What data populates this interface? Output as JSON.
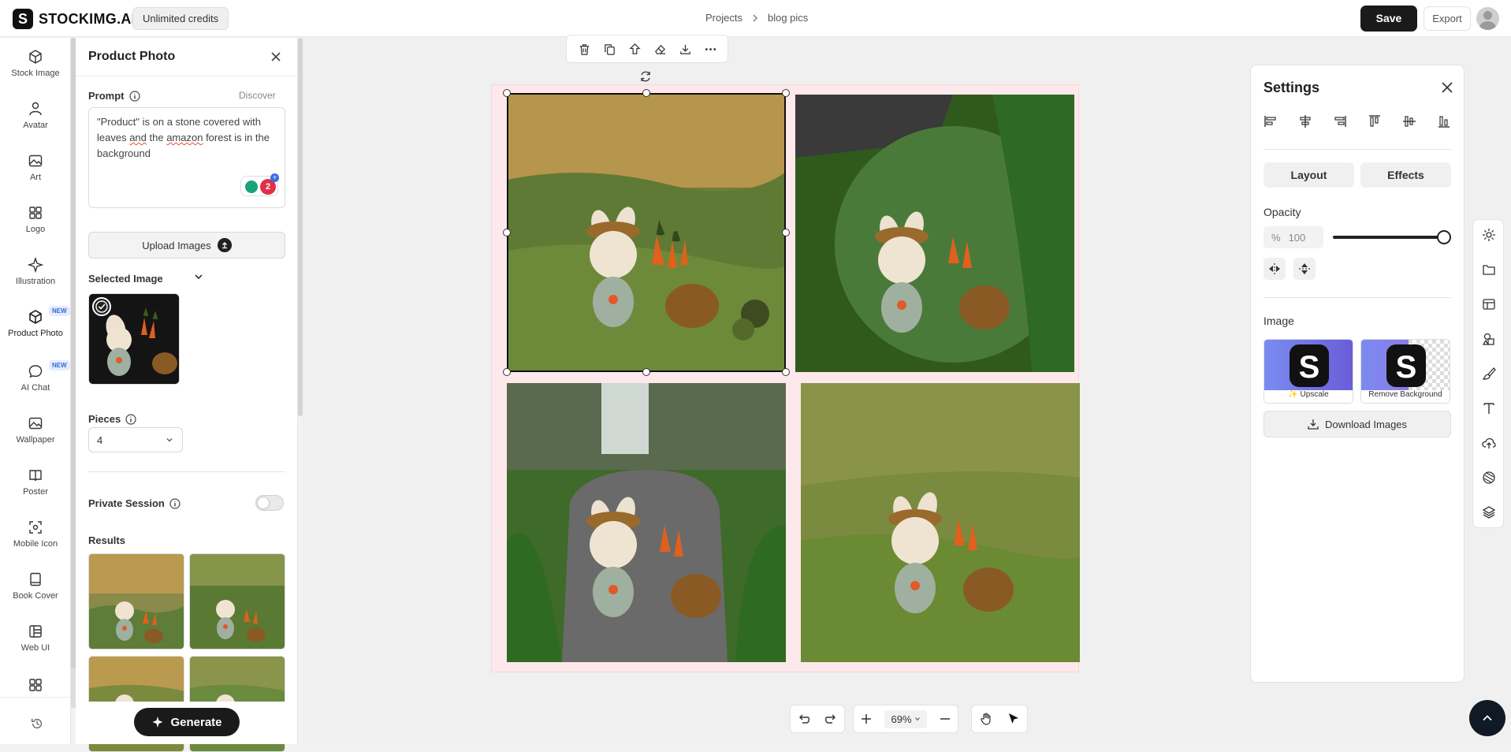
{
  "header": {
    "logo_letter": "S",
    "brand": "STOCKIMG.AI",
    "credits": "Unlimited credits",
    "breadcrumb": [
      "Projects",
      "blog pics"
    ],
    "save_label": "Save",
    "export_label": "Export"
  },
  "nav": {
    "items": [
      {
        "label": "Stock Image",
        "icon": "cube-icon"
      },
      {
        "label": "Avatar",
        "icon": "person-icon"
      },
      {
        "label": "Art",
        "icon": "image-icon"
      },
      {
        "label": "Logo",
        "icon": "grid-icon"
      },
      {
        "label": "Illustration",
        "icon": "sparkle-icon"
      },
      {
        "label": "Product Photo",
        "icon": "box-icon",
        "badge": "NEW",
        "active": true
      },
      {
        "label": "AI Chat",
        "icon": "chat-icon",
        "badge": "NEW"
      },
      {
        "label": "Wallpaper",
        "icon": "image-icon"
      },
      {
        "label": "Poster",
        "icon": "book-icon"
      },
      {
        "label": "Mobile Icon",
        "icon": "target-icon"
      },
      {
        "label": "Book Cover",
        "icon": "book-icon"
      },
      {
        "label": "Web UI",
        "icon": "layout-icon"
      }
    ]
  },
  "panel": {
    "title": "Product Photo",
    "prompt_label": "Prompt",
    "discover_label": "Discover",
    "prompt_parts": [
      "\"Product\" is on a stone covered with leaves ",
      "and",
      " the ",
      "amazon",
      " forest is in the background"
    ],
    "grammarly_count": "2",
    "upload_label": "Upload Images",
    "selected_label": "Selected Image",
    "pieces_label": "Pieces",
    "pieces_value": "4",
    "private_label": "Private Session",
    "private_on": false,
    "results_label": "Results",
    "generate_label": "Generate"
  },
  "settings": {
    "title": "Settings",
    "tabs": [
      "Layout",
      "Effects"
    ],
    "opacity_label": "Opacity",
    "opacity_unit": "%",
    "opacity_value": "100",
    "opacity_fraction": 1.0,
    "image_label": "Image",
    "cards": [
      "✨ Upscale",
      "Remove Background"
    ],
    "download_label": "Download Images"
  },
  "bottombar": {
    "zoom": "69%"
  },
  "colors": {
    "accent": "#1a1a1a",
    "artboard": "#fde8ec",
    "fab": "#0f1a24"
  }
}
